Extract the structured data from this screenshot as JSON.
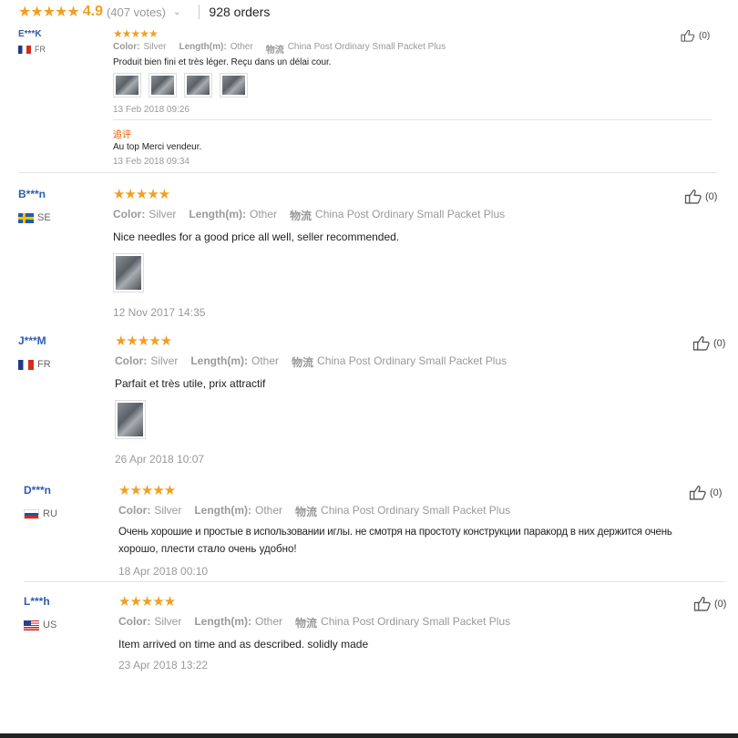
{
  "summary": {
    "stars": "★★★★★",
    "rating": "4.9",
    "votes": "(407 votes)",
    "orders": "928 orders"
  },
  "reviews": [
    {
      "user": "E***K",
      "country": "FR",
      "flag": "fr",
      "stars": "★★★★★",
      "color_label": "Color:",
      "color": "Silver",
      "length_label": "Length(m):",
      "length": "Other",
      "ship_label": "物流",
      "shipping": "China Post Ordinary Small Packet Plus",
      "text": "Produit bien fini et très léger. Reçu dans un délai cour.",
      "photos": 4,
      "date": "13 Feb 2018 09:26",
      "followup_label": "追评",
      "followup_text": "Au top Merci vendeur.",
      "followup_date": "13 Feb 2018 09:34",
      "helpful": "(0)"
    },
    {
      "user": "B***n",
      "country": "SE",
      "flag": "se",
      "stars": "★★★★★",
      "color_label": "Color:",
      "color": "Silver",
      "length_label": "Length(m):",
      "length": "Other",
      "ship_label": "物流",
      "shipping": "China Post Ordinary Small Packet Plus",
      "text": "Nice needles for a good price all well, seller recommended.",
      "photos": 1,
      "date": "12 Nov 2017 14:35",
      "helpful": "(0)"
    },
    {
      "user": "J***M",
      "country": "FR",
      "flag": "fr",
      "stars": "★★★★★",
      "color_label": "Color:",
      "color": "Silver",
      "length_label": "Length(m):",
      "length": "Other",
      "ship_label": "物流",
      "shipping": "China Post Ordinary Small Packet Plus",
      "text": "Parfait et très utile, prix attractif",
      "photos": 1,
      "date": "26 Apr 2018 10:07",
      "helpful": "(0)"
    },
    {
      "user": "D***n",
      "country": "RU",
      "flag": "ru",
      "stars": "★★★★★",
      "color_label": "Color:",
      "color": "Silver",
      "length_label": "Length(m):",
      "length": "Other",
      "ship_label": "物流",
      "shipping": "China Post Ordinary Small Packet Plus",
      "text_line1": "Очень хорошие и простые в использовании иглы. не смотря на простоту конструкции паракорд в них держится очень",
      "text_line2": "хорошо, плести стало очень удобно!",
      "date": "18 Apr 2018 00:10",
      "helpful": "(0)"
    },
    {
      "user": "L***h",
      "country": "US",
      "flag": "us",
      "stars": "★★★★★",
      "color_label": "Color:",
      "color": "Silver",
      "length_label": "Length(m):",
      "length": "Other",
      "ship_label": "物流",
      "shipping": "China Post Ordinary Small Packet Plus",
      "text": "Item arrived on time and as described. solidly made",
      "date": "23 Apr 2018 13:22",
      "helpful": "(0)"
    }
  ]
}
